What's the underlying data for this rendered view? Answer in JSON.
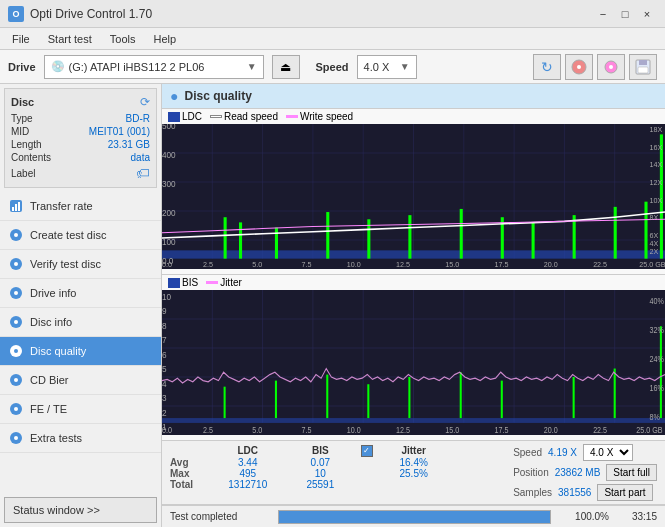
{
  "titleBar": {
    "title": "Opti Drive Control 1.70",
    "minimizeLabel": "−",
    "maximizeLabel": "□",
    "closeLabel": "×"
  },
  "menuBar": {
    "items": [
      "File",
      "Start test",
      "Tools",
      "Help"
    ]
  },
  "driveBar": {
    "driveLabel": "Drive",
    "driveValue": "(G:)  ATAPI iHBS112  2 PL06",
    "speedLabel": "Speed",
    "speedValue": "4.0 X"
  },
  "discPanel": {
    "title": "Disc",
    "typeLabel": "Type",
    "typeValue": "BD-R",
    "midLabel": "MID",
    "midValue": "MEIT01 (001)",
    "lengthLabel": "Length",
    "lengthValue": "23.31 GB",
    "contentsLabel": "Contents",
    "contentsValue": "data",
    "labelLabel": "Label"
  },
  "navItems": [
    {
      "label": "Transfer rate",
      "icon": "transfer-icon"
    },
    {
      "label": "Create test disc",
      "icon": "create-icon"
    },
    {
      "label": "Verify test disc",
      "icon": "verify-icon"
    },
    {
      "label": "Drive info",
      "icon": "drive-icon"
    },
    {
      "label": "Disc info",
      "icon": "disc-info-icon"
    },
    {
      "label": "Disc quality",
      "icon": "disc-quality-icon",
      "active": true
    },
    {
      "label": "CD Bier",
      "icon": "cd-bier-icon"
    },
    {
      "label": "FE / TE",
      "icon": "fe-te-icon"
    },
    {
      "label": "Extra tests",
      "icon": "extra-icon"
    }
  ],
  "statusWindowLabel": "Status window >>",
  "discQuality": {
    "title": "Disc quality",
    "legendLDC": "LDC",
    "legendReadSpeed": "Read speed",
    "legendWriteSpeed": "Write speed",
    "legendBIS": "BIS",
    "legendJitter": "Jitter",
    "yAxisMax1": "500",
    "yAxisLabels1": [
      "500",
      "400",
      "300",
      "200",
      "100",
      "0.0"
    ],
    "yAxisRight1": [
      "18X",
      "16X",
      "14X",
      "12X",
      "10X",
      "8X",
      "6X",
      "4X",
      "2X"
    ],
    "xAxisLabels": [
      "0.0",
      "2.5",
      "5.0",
      "7.5",
      "10.0",
      "12.5",
      "15.0",
      "17.5",
      "20.0",
      "22.5",
      "25.0 GB"
    ],
    "yAxisMax2": "10",
    "yAxisLabels2": [
      "10",
      "9",
      "8",
      "7",
      "6",
      "5",
      "4",
      "3",
      "2",
      "1"
    ],
    "yAxisRight2": [
      "40%",
      "32%",
      "24%",
      "16%",
      "8%"
    ],
    "stats": {
      "avgLDC": "3.44",
      "avgBIS": "0.07",
      "avgJitter": "16.4%",
      "maxLDC": "495",
      "maxBIS": "10",
      "maxJitter": "25.5%",
      "totalLDC": "1312710",
      "totalBIS": "25591"
    },
    "speed": {
      "speedLabel": "Speed",
      "speedValue": "4.19 X",
      "speedDropdown": "4.0 X",
      "positionLabel": "Position",
      "positionValue": "23862 MB",
      "samplesLabel": "Samples",
      "samplesValue": "381556"
    },
    "buttons": {
      "startFull": "Start full",
      "startPart": "Start part"
    },
    "jitterLabel": "Jitter",
    "jitterChecked": true
  },
  "statusBar": {
    "statusText": "Test completed",
    "progressPct": "100.0%",
    "timeValue": "33:15"
  }
}
